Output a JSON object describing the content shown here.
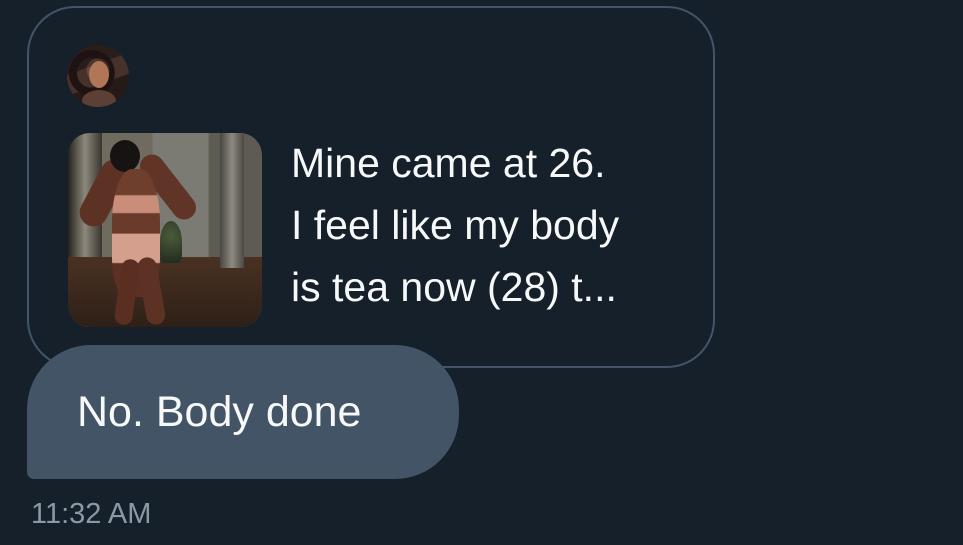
{
  "conversation": {
    "quoted_post": {
      "avatar_icon": "profile-avatar",
      "media_icon": "photo-thumbnail",
      "text": "Mine came at 26.\nI feel like my body\nis tea now (28) t..."
    },
    "message": {
      "text": "No. Body done"
    },
    "timestamp": "11:32 AM"
  },
  "colors": {
    "background": "#15202b",
    "card_border": "#425466",
    "message_bubble": "#425466",
    "primary_text": "#f7f9f9",
    "secondary_text": "#8b98a5"
  }
}
